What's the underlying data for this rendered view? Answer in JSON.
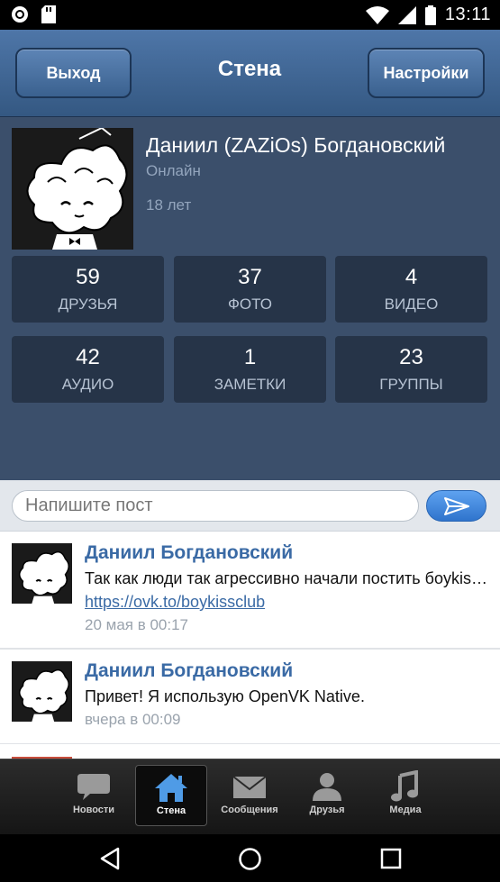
{
  "status_bar": {
    "time": "13:11"
  },
  "header": {
    "back_label": "Выход",
    "title": "Стена",
    "settings_label": "Настройки",
    "accent": "#4e76a8"
  },
  "profile": {
    "name": "Даниил (ZAZiOs) Богдановский",
    "status": "Онлайн",
    "age": "18 лет",
    "counters": [
      {
        "count": "59",
        "label": "ДРУЗЬЯ"
      },
      {
        "count": "37",
        "label": "ФОТО"
      },
      {
        "count": "4",
        "label": "ВИДЕО"
      },
      {
        "count": "42",
        "label": "АУДИО"
      },
      {
        "count": "1",
        "label": "ЗАМЕТКИ"
      },
      {
        "count": "23",
        "label": "ГРУППЫ"
      }
    ]
  },
  "composer": {
    "placeholder": "Напишите пост"
  },
  "posts": [
    {
      "author": "Даниил Богдановский",
      "text": "Так как люди так агрессивно начали постить боykissers на стене",
      "link": "https://ovk.to/boykissclub",
      "date": "20 мая в 00:17"
    },
    {
      "author": "Даниил Богдановский",
      "text": "Привет! Я использую OpenVK Native.",
      "date": "вчера в 00:09"
    }
  ],
  "tabs": [
    {
      "label": "Новости",
      "icon": "chat-bubble-icon"
    },
    {
      "label": "Стена",
      "icon": "home-icon"
    },
    {
      "label": "Сообщения",
      "icon": "envelope-icon"
    },
    {
      "label": "Друзья",
      "icon": "person-icon"
    },
    {
      "label": "Медиа",
      "icon": "music-note-icon"
    }
  ]
}
